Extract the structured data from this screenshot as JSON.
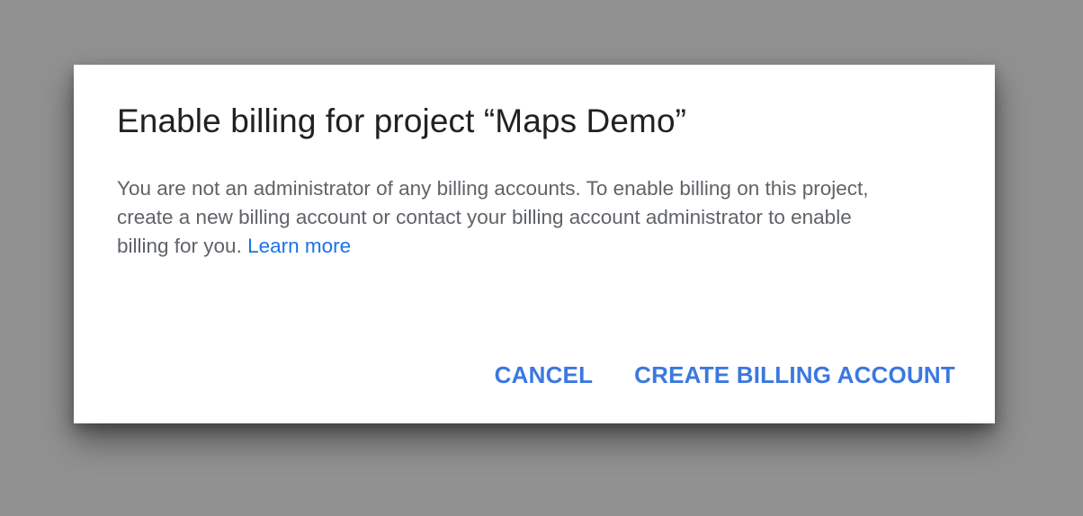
{
  "dialog": {
    "title": "Enable billing for project “Maps Demo”",
    "body_text": "You are not an administrator of any billing accounts. To enable billing on this project, create a new billing account or contact your billing account administrator to enable billing for you.",
    "learn_more_label": "Learn more",
    "cancel_label": "CANCEL",
    "create_label": "CREATE BILLING ACCOUNT"
  },
  "colors": {
    "backdrop": "#919191",
    "dialog_bg": "#ffffff",
    "title": "#202124",
    "body": "#5f6368",
    "accent": "#3b78e0"
  }
}
